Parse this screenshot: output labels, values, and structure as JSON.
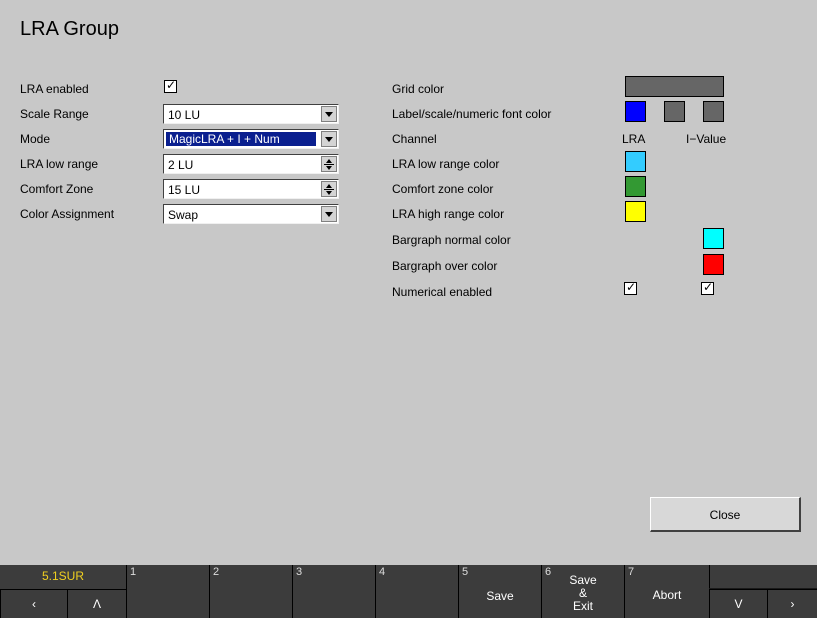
{
  "title": "LRA Group",
  "left_settings": {
    "lra_enabled": {
      "label": "LRA enabled",
      "checked": true
    },
    "scale_range": {
      "label": "Scale Range",
      "value": "10 LU"
    },
    "mode": {
      "label": "Mode",
      "value": "MagicLRA + I + Num"
    },
    "lra_low_range": {
      "label": "LRA low range",
      "value": "2 LU"
    },
    "comfort_zone": {
      "label": "Comfort Zone",
      "value": "15 LU"
    },
    "color_assignment": {
      "label": "Color Assignment",
      "value": "Swap"
    }
  },
  "right_settings": {
    "grid_color": {
      "label": "Grid color",
      "color": "#666666"
    },
    "font_color": {
      "label": "Label/scale/numeric font color",
      "colors": [
        "#0000ff",
        "#666666",
        "#666666"
      ]
    },
    "channel": {
      "label": "Channel",
      "col1": "LRA",
      "col2": "I−Value"
    },
    "lra_low_color": {
      "label": "LRA low range color",
      "color": "#33ccff"
    },
    "comfort_color": {
      "label": "Comfort zone color",
      "color": "#339933"
    },
    "lra_high_color": {
      "label": "LRA high range color",
      "color": "#ffff00"
    },
    "bar_normal_color": {
      "label": "Bargraph normal color",
      "color": "#00ffff"
    },
    "bar_over_color": {
      "label": "Bargraph over color",
      "color": "#ff0000"
    },
    "numerical_enabled": {
      "label": "Numerical enabled",
      "lra_checked": true,
      "ivalue_checked": true
    }
  },
  "close_label": "Close",
  "softkeys": {
    "preset": "5.1SUR",
    "left_arrow": "‹",
    "up_arrow": "Λ",
    "f1": {
      "num": "1",
      "label": ""
    },
    "f2": {
      "num": "2",
      "label": ""
    },
    "f3": {
      "num": "3",
      "label": ""
    },
    "f4": {
      "num": "4",
      "label": ""
    },
    "f5": {
      "num": "5",
      "label": "Save"
    },
    "f6": {
      "num": "6",
      "label_lines": [
        "Save",
        "&",
        "Exit"
      ]
    },
    "f7": {
      "num": "7",
      "label": "Abort"
    },
    "down_arrow": "V",
    "right_arrow": "›"
  }
}
